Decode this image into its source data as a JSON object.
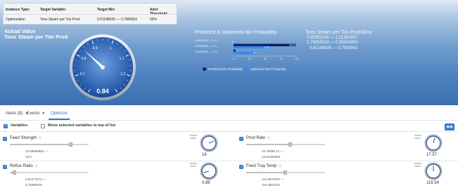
{
  "info_table": {
    "headers": [
      "Instance Type:",
      "Target Variable:",
      "Target Bin:",
      "Alert Threshold:"
    ],
    "values": [
      "Optimization",
      "Tons Steam per Ton Prod",
      "0.61198926 — 0.7906561",
      "50%"
    ]
  },
  "gauge": {
    "title_line1": "Actual Value",
    "title_line2": "Tons Steam per Ton Prod",
    "value": 0.84,
    "value_label": "0.84",
    "min": 0.6,
    "max": 1.3,
    "tick_labels": [
      "0.7",
      "0.8",
      "0.9",
      "1",
      "1.1",
      "1.2"
    ]
  },
  "bin_chart": {
    "title": "Predicted & Optimized Bin Probability",
    "chart_data": {
      "type": "bar",
      "orientation": "horizontal",
      "categories": [
        "0.95051104 — 1.21...",
        "0.79059519 — 0.9...",
        "0.61198926 — 0.79..."
      ],
      "series": [
        {
          "name": "Predicted Bin Probability",
          "color": "#0f1f5c",
          "values": [
            0,
            98,
            3
          ],
          "labels": [
            "",
            "98.44",
            ""
          ]
        },
        {
          "name": "Optimized Bin Probability",
          "color": "#2f8cf0",
          "values": [
            5,
            58,
            41
          ],
          "labels": [
            "5.44",
            "57.64",
            "94.74"
          ]
        }
      ],
      "xlim": [
        0,
        100
      ],
      "xticks": [
        "0",
        "25",
        "50",
        "75",
        "100"
      ],
      "legend_position": "bottom"
    }
  },
  "bins_block": {
    "title": "Tons Steam per Ton Prod Bins",
    "rows": [
      "0.95051104 — 1.21391457",
      "0.79059519 — 0.95004083",
      "0.61198926 — 0.7906561"
    ]
  },
  "tabs": {
    "alerts": "Alerts (8)",
    "events": "Events",
    "optimize": "Optimize"
  },
  "vars_row": {
    "variables_label": "Variables",
    "move_label": "Move selected variables to top of list"
  },
  "variables": [
    {
      "name": "Feed Strength",
      "range_low": "16.69999962 —",
      "range_high": "19.5",
      "actual_label_1": "Actual",
      "actual_label_2": "Value",
      "value": "18",
      "fill": 0.78
    },
    {
      "name": "Prod Rate",
      "range_low": "16.76998 12 —",
      "range_high": "18.61969383",
      "actual_label_1": "Actual",
      "actual_label_2": "Value",
      "value": "17.57",
      "fill": 0.56
    },
    {
      "name": "Reflux Ratio",
      "range_low": "0.52471674 —",
      "range_high": "0.75060576",
      "actual_label_1": "Actual",
      "actual_label_2": "Value",
      "value": "0.86",
      "fill": 0.06
    },
    {
      "name": "Feed Tray Temp",
      "range_low": "114.8570281 —",
      "range_high": "115.0651754",
      "actual_label_1": "Actual",
      "actual_label_2": "Value",
      "value": "116.54",
      "fill": 0.5
    }
  ],
  "colors": {
    "accent": "#2a77c9",
    "predicted": "#0f1f5c",
    "optimized": "#2f8cf0"
  }
}
